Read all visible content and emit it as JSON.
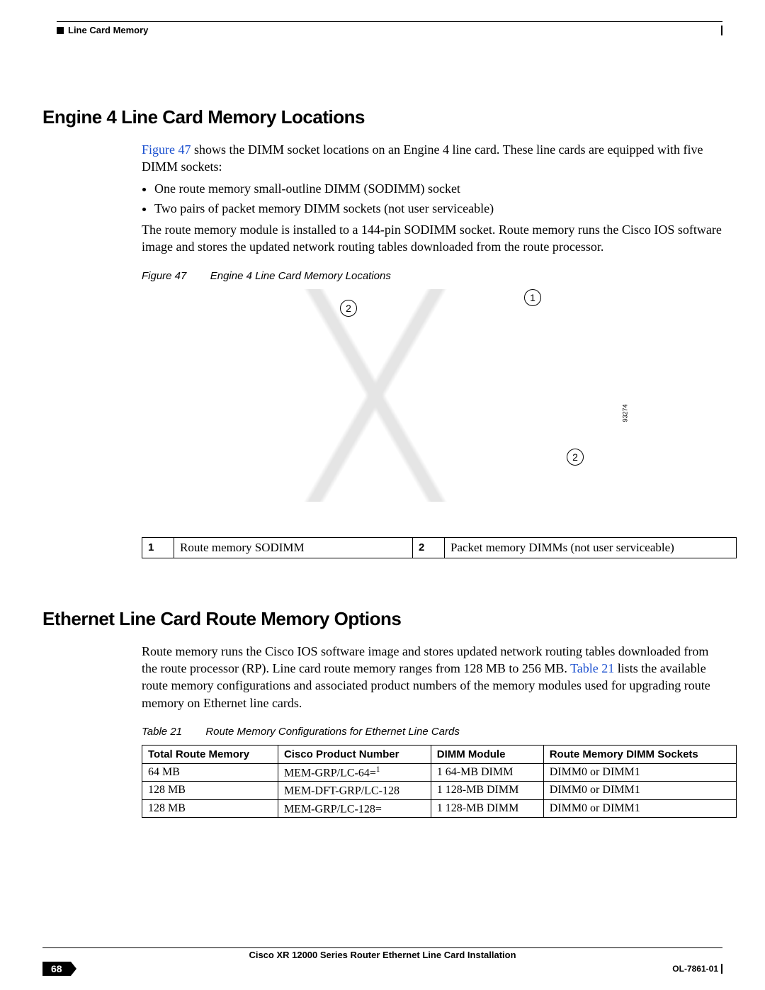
{
  "header": {
    "section_title": "Line Card Memory"
  },
  "section1": {
    "heading": "Engine 4 Line Card Memory Locations",
    "para1_link": "Figure 47",
    "para1_rest": " shows the DIMM socket locations on an Engine 4 line card. These line cards are equipped with five DIMM sockets:",
    "bullet1": "One route memory small-outline DIMM (SODIMM) socket",
    "bullet2": "Two pairs of packet memory DIMM sockets (not user serviceable)",
    "para2": "The route memory module is installed to a 144-pin SODIMM socket. Route memory runs the Cisco IOS software image and stores the updated network routing tables downloaded from the route processor.",
    "figure": {
      "label": "Figure 47",
      "title": "Engine 4 Line Card Memory Locations",
      "callout1": "1",
      "callout2a": "2",
      "callout2b": "2",
      "ref_id": "93274"
    },
    "legend": {
      "n1": "1",
      "t1": "Route memory SODIMM",
      "n2": "2",
      "t2": "Packet memory DIMMs (not user serviceable)"
    }
  },
  "section2": {
    "heading": "Ethernet Line Card Route Memory Options",
    "para1a": "Route memory runs the Cisco IOS software image and stores updated network routing tables downloaded from the route processor (RP). Line card route memory ranges from 128 MB to 256 MB. ",
    "para1_link": "Table 21",
    "para1b": " lists the available route memory configurations and associated product numbers of the memory modules used for upgrading route memory on Ethernet line cards.",
    "table": {
      "label": "Table 21",
      "title": "Route Memory Configurations for Ethernet Line Cards",
      "headers": [
        "Total Route Memory",
        "Cisco Product Number",
        "DIMM Module",
        "Route Memory DIMM Sockets"
      ],
      "rows": [
        {
          "c0": "64 MB",
          "c1_pre": "MEM-GRP/LC-64=",
          "c1_sup": "1",
          "c2": "1 64-MB DIMM",
          "c3": "DIMM0 or DIMM1"
        },
        {
          "c0": "128 MB",
          "c1_pre": "MEM-DFT-GRP/LC-128",
          "c1_sup": "",
          "c2": "1 128-MB DIMM",
          "c3": "DIMM0 or DIMM1"
        },
        {
          "c0": "128 MB",
          "c1_pre": "MEM-GRP/LC-128=",
          "c1_sup": "",
          "c2": "1 128-MB DIMM",
          "c3": "DIMM0 or DIMM1"
        }
      ]
    }
  },
  "footer": {
    "doc_title": "Cisco XR 12000 Series Router Ethernet Line Card Installation",
    "page_num": "68",
    "doc_id": "OL-7861-01"
  }
}
